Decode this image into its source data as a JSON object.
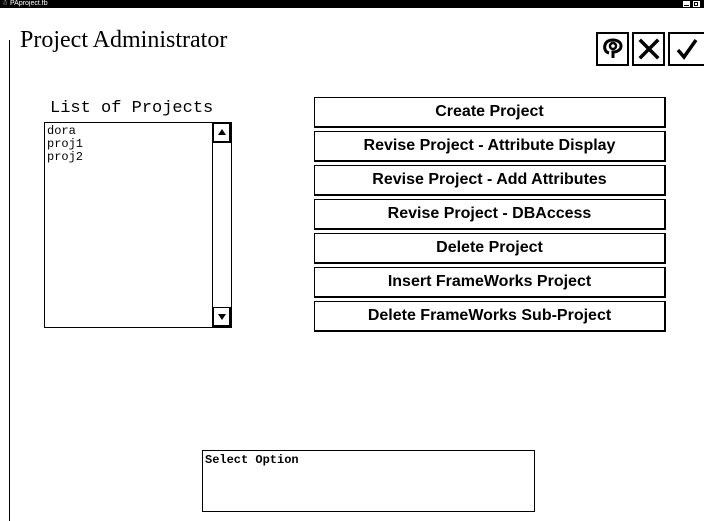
{
  "window": {
    "title": "PAproject.fb"
  },
  "header": {
    "title": "Project Administrator"
  },
  "toolbar": {
    "buttons": [
      {
        "icon": "help-icon"
      },
      {
        "icon": "close-icon"
      },
      {
        "icon": "check-icon"
      }
    ]
  },
  "projects": {
    "label": "List of Projects",
    "items": [
      "dora",
      "proj1",
      "proj2"
    ]
  },
  "actions": [
    "Create Project",
    "Revise Project - Attribute Display",
    "Revise Project - Add Attributes",
    "Revise Project - DBAccess",
    "Delete Project",
    "Insert FrameWorks Project",
    "Delete FrameWorks Sub-Project"
  ],
  "status": {
    "text": "Select Option"
  }
}
